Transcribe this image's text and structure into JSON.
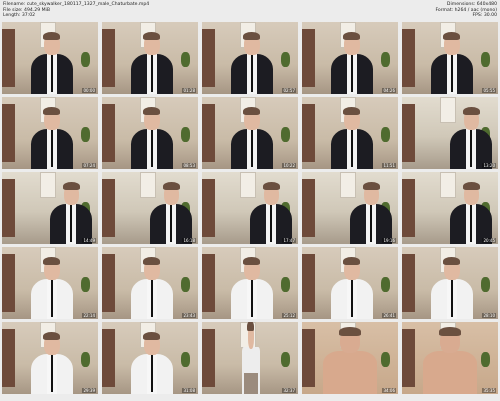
{
  "header": {
    "filename": "Filename: cute_skywalker_180117_1327_male_Chaturbate.mp4",
    "filesize": "File size: 494.29 MiB",
    "length": "Length: 37:02",
    "dimensions": "Dimensions: 640x480",
    "format": "Format: h264 / aac (mono)",
    "fps": "FPS: 30.00"
  },
  "thumbnails": [
    {
      "time": "00:00",
      "kind": "suit"
    },
    {
      "time": "01:28",
      "kind": "suit"
    },
    {
      "time": "02:57",
      "kind": "suit"
    },
    {
      "time": "04:26",
      "kind": "suit"
    },
    {
      "time": "05:55",
      "kind": "suit"
    },
    {
      "time": "07:24",
      "kind": "suit"
    },
    {
      "time": "08:53",
      "kind": "suit"
    },
    {
      "time": "10:22",
      "kind": "suit"
    },
    {
      "time": "11:51",
      "kind": "suit"
    },
    {
      "time": "13:20",
      "kind": "office"
    },
    {
      "time": "14:49",
      "kind": "office"
    },
    {
      "time": "16:18",
      "kind": "office"
    },
    {
      "time": "17:47",
      "kind": "office"
    },
    {
      "time": "19:16",
      "kind": "office"
    },
    {
      "time": "20:45",
      "kind": "office"
    },
    {
      "time": "22:14",
      "kind": "white"
    },
    {
      "time": "23:43",
      "kind": "white"
    },
    {
      "time": "25:12",
      "kind": "white"
    },
    {
      "time": "26:41",
      "kind": "white"
    },
    {
      "time": "28:10",
      "kind": "white"
    },
    {
      "time": "29:39",
      "kind": "white"
    },
    {
      "time": "31:08",
      "kind": "white"
    },
    {
      "time": "32:37",
      "kind": "standing"
    },
    {
      "time": "34:06",
      "kind": "shirtless"
    },
    {
      "time": "35:35",
      "kind": "shirtless"
    }
  ]
}
